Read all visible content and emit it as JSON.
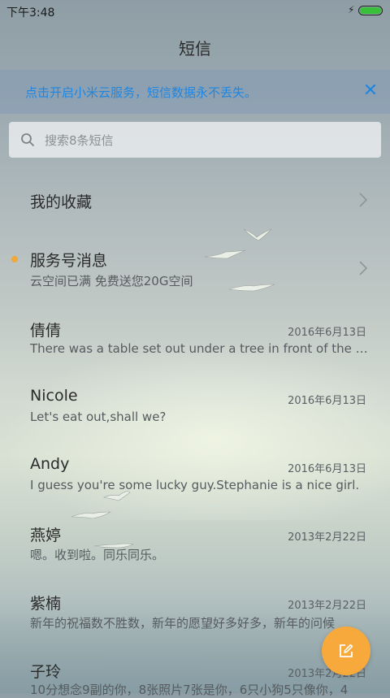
{
  "status_bar": {
    "time": "下午3:48"
  },
  "header": {
    "title": "短信"
  },
  "banner": {
    "text": "点击开启小米云服务，短信数据永不丢失。",
    "close_icon": "close-icon",
    "color": "#1f86e0"
  },
  "search": {
    "placeholder": "搜索8条短信",
    "value": ""
  },
  "favorites": {
    "label": "我的收藏"
  },
  "service": {
    "title": "服务号消息",
    "subtitle": "云空间已满 免费送您20G空间",
    "unread_color": "#f0a83a"
  },
  "conversations": [
    {
      "name": "倩倩",
      "date": "2016年6月13日",
      "preview": "There was a table set out under a tree in front of the house"
    },
    {
      "name": "Nicole",
      "date": "2016年6月13日",
      "preview": "Let's eat out,shall we?"
    },
    {
      "name": "Andy",
      "date": "2016年6月13日",
      "preview": "I guess you're some lucky guy.Stephanie is a nice girl."
    },
    {
      "name": "燕婷",
      "date": "2013年2月22日",
      "preview": "嗯。收到啦。同乐同乐。"
    },
    {
      "name": "紫楠",
      "date": "2013年2月22日",
      "preview": "新年的祝福数不胜数，新年的愿望好多好多，新年的问候"
    },
    {
      "name": "子玲",
      "date": "2013年2月22日",
      "preview": "10分想念9副的你，8张照片7张是你，6只小狗5只像你，4"
    }
  ],
  "fab": {
    "icon": "compose-icon",
    "color": "#f7a93b"
  }
}
